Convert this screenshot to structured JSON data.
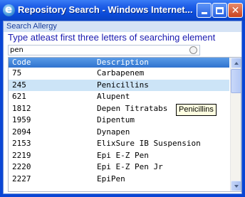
{
  "window": {
    "title": "Repository Search - Windows Internet..."
  },
  "search": {
    "section_title": "Search Allergy",
    "instruction": "Type atleast first three letters of searching element",
    "value": "pen"
  },
  "table": {
    "headers": [
      "Code",
      "Description"
    ],
    "rows": [
      {
        "code": "75",
        "description": "Carbapenem"
      },
      {
        "code": "245",
        "description": "Penicillins"
      },
      {
        "code": "621",
        "description": "Alupent"
      },
      {
        "code": "1812",
        "description": "Depen Titratabs"
      },
      {
        "code": "1959",
        "description": "Dipentum"
      },
      {
        "code": "2094",
        "description": "Dynapen"
      },
      {
        "code": "2153",
        "description": "ElixSure IB Suspension"
      },
      {
        "code": "2219",
        "description": "Epi E-Z Pen"
      },
      {
        "code": "2220",
        "description": "Epi E-Z Pen Jr"
      },
      {
        "code": "2227",
        "description": "EpiPen"
      }
    ],
    "selected_index": 1
  },
  "tooltip": "Penicillins",
  "icons": [
    "ie-icon",
    "minimize-icon",
    "maximize-icon",
    "close-icon",
    "clear-search-icon",
    "scroll-up-icon",
    "scroll-down-icon"
  ]
}
